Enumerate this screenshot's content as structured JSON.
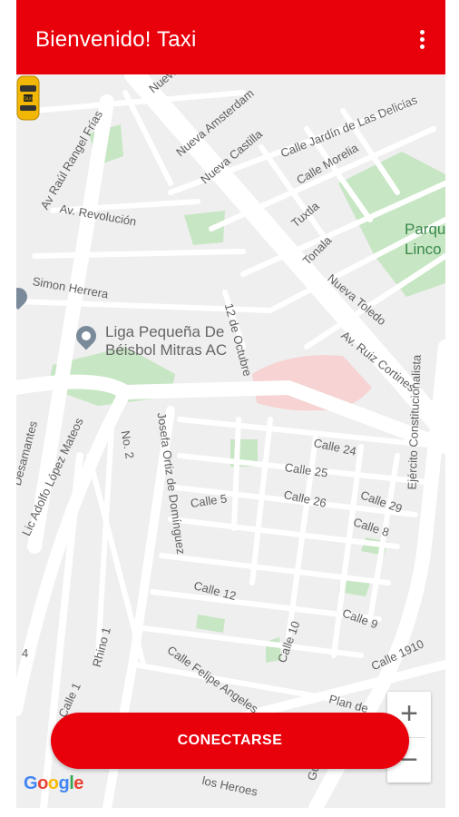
{
  "appbar": {
    "title": "Bienvenido! Taxi",
    "menu_icon": "more-vert-icon"
  },
  "map": {
    "poi_name_line1": "Liga Pequeña De",
    "poi_name_line2": "Béisbol Mitras AC",
    "park_line1": "Parqu",
    "park_line2": "Linco",
    "streets": [
      "Nueva Ca",
      "Nueva Amsterdam",
      "Nueva Castilla",
      "Calle Jardín de Las Delicias",
      "Calle Morelia",
      "Tuxtla",
      "Tonala",
      "Nueva Toledo",
      "Av. Ruiz Cortines",
      "Av Raúl Rangel Frías",
      "Av. Revolución",
      "Simon Herrera",
      "12 de Octubre",
      "Desamantes",
      "Lic Adolfo López Mateos",
      "No. 2",
      "Josefa Ortiz de Domínguez",
      "Calle 24",
      "Calle 25",
      "Calle 26",
      "Calle 29",
      "Calle 8",
      "Calle 5",
      "Ejército Constitucionalista",
      "Calle 12",
      "Calle 9",
      "Calle 10",
      "Calle 1910",
      "Calle Felipe Angeles",
      "Calle 1",
      "Rhino 1",
      "Plan de",
      "los Heroes",
      "Guerr",
      "4",
      "9"
    ],
    "marker_icon": "taxi-icon",
    "zoom_in": "+",
    "zoom_out": "−",
    "attribution": [
      "G",
      "o",
      "o",
      "g",
      "l",
      "e"
    ]
  },
  "connect_button": "CONECTARSE",
  "colors": {
    "primary": "#e8000b",
    "map_bg": "#efefef",
    "park": "#c7e6c3",
    "poi_area": "#f7d3d3"
  }
}
